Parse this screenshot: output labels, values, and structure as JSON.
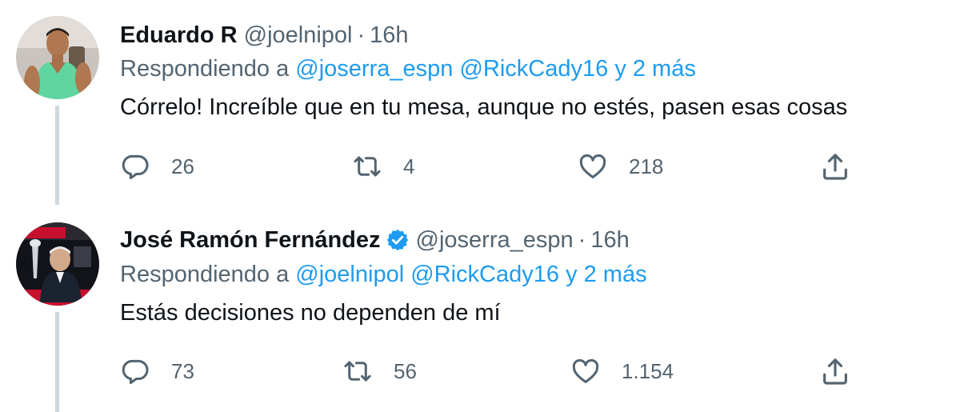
{
  "tweets": [
    {
      "name": "Eduardo R",
      "handle": "@joelnipol",
      "separator": "·",
      "time": "16h",
      "replying_prefix": "Respondiendo a",
      "mention_1": "@joserra_espn",
      "mention_2": "@RickCady16",
      "more": "y 2 más",
      "text": "Córrelo! Increíble que en tu mesa, aunque no estés, pasen esas cosas",
      "replies": "26",
      "retweets": "4",
      "likes": "218",
      "verified": false,
      "avatar_icon": "user-avatar-green-shirt"
    },
    {
      "name": "José Ramón Fernández",
      "handle": "@joserra_espn",
      "separator": "·",
      "time": "16h",
      "replying_prefix": "Respondiendo a",
      "mention_1": "@joelnipol",
      "mention_2": "@RickCady16",
      "more": "y 2 más",
      "text": "Estás decisiones no dependen de mí",
      "replies": "73",
      "retweets": "56",
      "likes": "1.154",
      "verified": true,
      "avatar_icon": "user-avatar-espn-super-bowl"
    }
  ],
  "icons": {
    "reply": "reply-icon",
    "retweet": "retweet-icon",
    "like": "heart-icon",
    "share": "share-icon",
    "verified": "verified-badge-icon"
  },
  "colors": {
    "text": "#0f1419",
    "secondary": "#536471",
    "link": "#1d9bf0",
    "thread_line": "#cfd9de",
    "verified": "#1d9bf0"
  }
}
